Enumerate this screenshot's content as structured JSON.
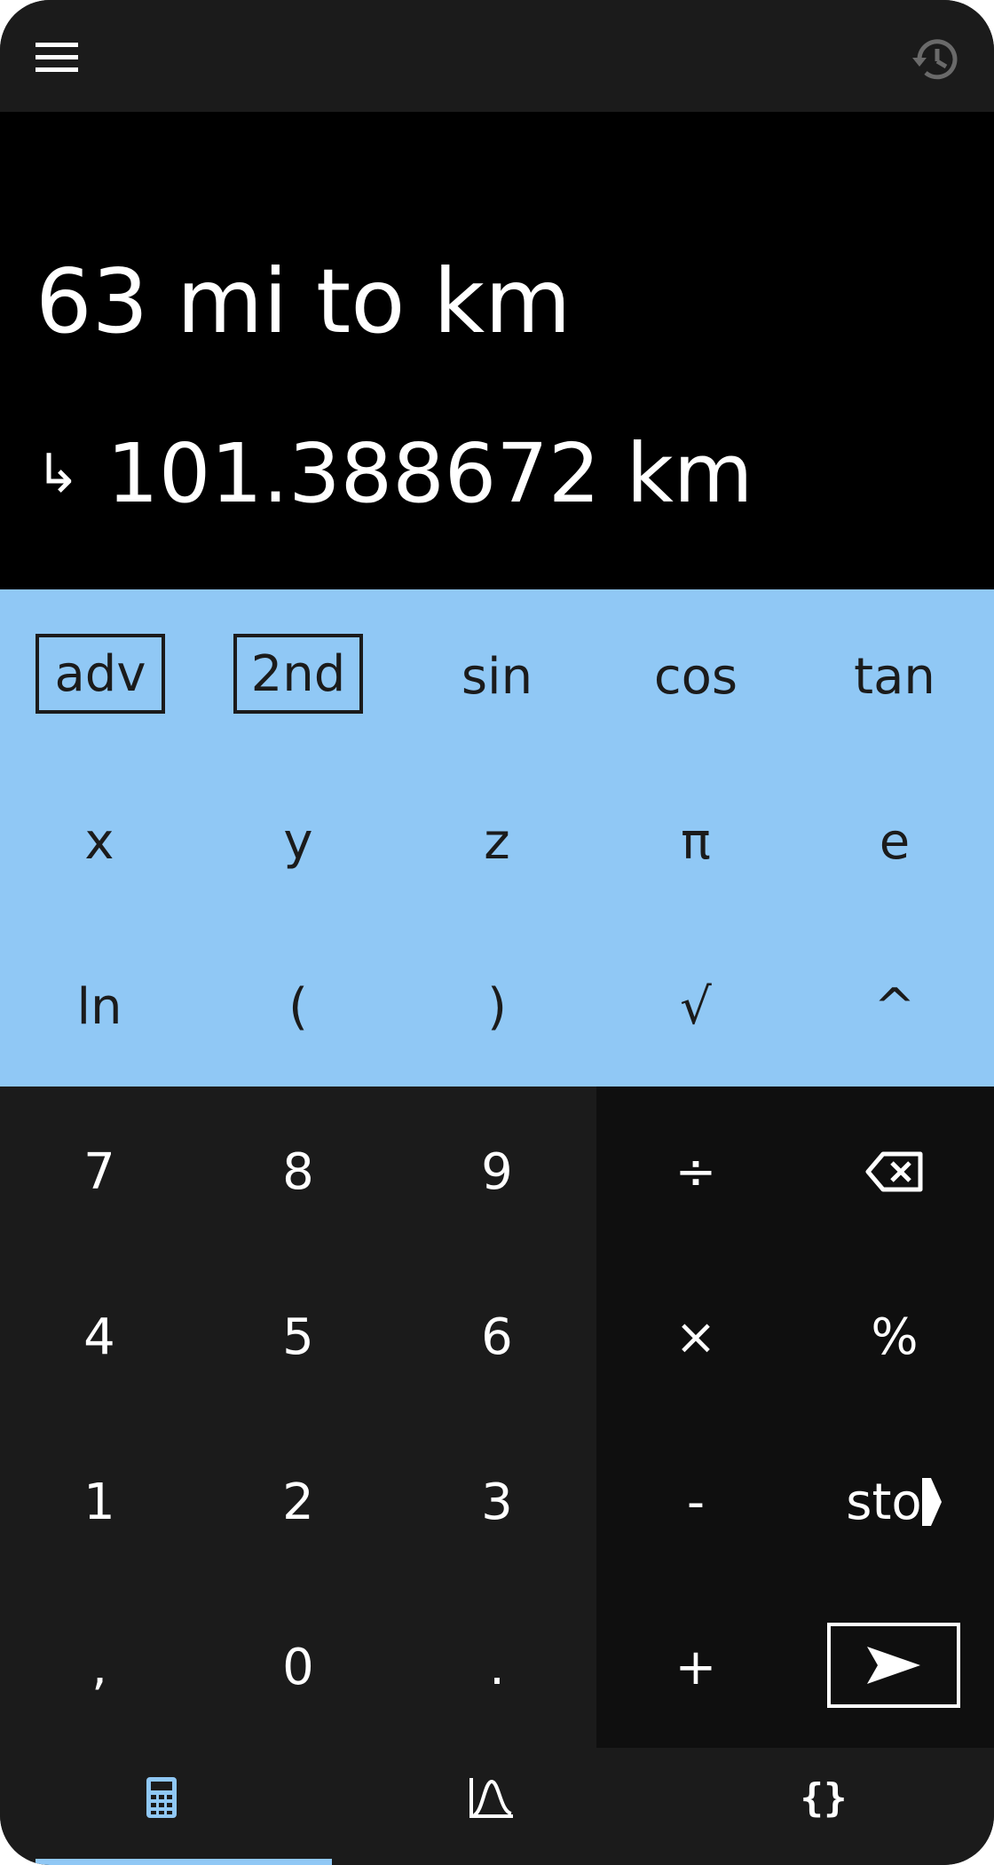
{
  "top_bar": {
    "menu_icon": "hamburger-menu-icon",
    "history_icon": "history-icon"
  },
  "display": {
    "expression": "63 mi to km",
    "result_arrow": "↳",
    "result": "101.388672 km"
  },
  "scientific_keys": {
    "row1": [
      "adv",
      "2nd",
      "sin",
      "cos",
      "tan"
    ],
    "row2": [
      "x",
      "y",
      "z",
      "π",
      "e"
    ],
    "row3": [
      "ln",
      "(",
      ")",
      "√",
      "^"
    ]
  },
  "number_keys": {
    "row1": [
      "7",
      "8",
      "9"
    ],
    "row2": [
      "4",
      "5",
      "6"
    ],
    "row3": [
      "1",
      "2",
      "3"
    ],
    "row4": [
      ",",
      "0",
      "."
    ]
  },
  "operator_keys": {
    "divide": "÷",
    "backspace_icon": "backspace-icon",
    "multiply": "×",
    "percent": "%",
    "minus": "-",
    "store": "sto",
    "plus": "+",
    "enter_icon": "send-arrow-icon"
  },
  "bottom_nav": {
    "items": [
      {
        "icon": "calculator-icon",
        "active": true
      },
      {
        "icon": "graph-icon",
        "active": false
      },
      {
        "icon": "braces-icon",
        "active": false
      }
    ]
  },
  "colors": {
    "accent": "#90c8f5",
    "background": "#1b1b1b",
    "display_background": "#000000",
    "operator_background": "#0f0f0f",
    "text_light": "#ffffff",
    "text_dark": "#1b1b1b"
  }
}
